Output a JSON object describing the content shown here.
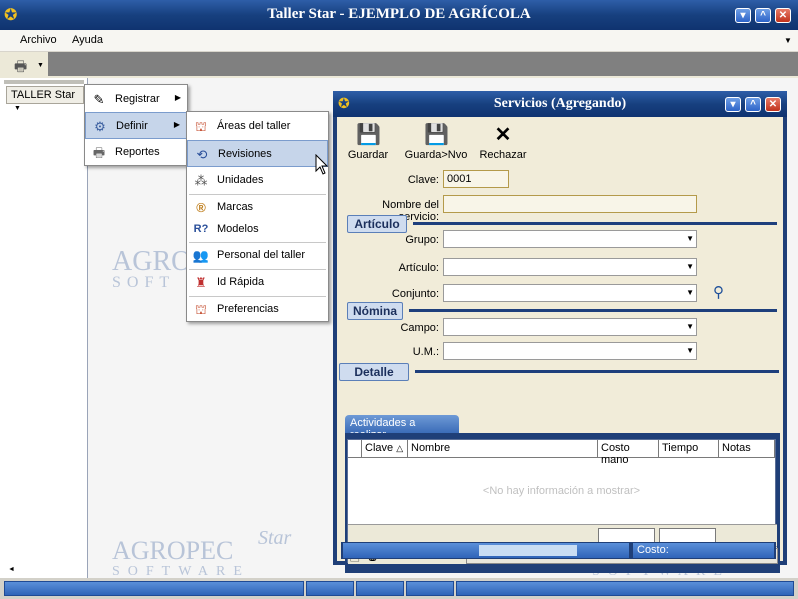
{
  "main_window": {
    "title": "Taller Star - EJEMPLO DE AGRÍCOLA",
    "menu": [
      "Archivo",
      "Ayuda"
    ],
    "taller_button": "TALLER Star"
  },
  "watermark": {
    "agropec": "AGROPEC",
    "agropec_short": "AGRO",
    "star": "Star",
    "software": "SOFTWARE",
    "soft_short": "SOFT"
  },
  "menu1": {
    "items": [
      {
        "label": "Registrar",
        "icon": "pencil-icon"
      },
      {
        "label": "Definir",
        "icon": "define-icon"
      },
      {
        "label": "Reportes",
        "icon": "printer-icon"
      }
    ]
  },
  "menu2": {
    "items": [
      {
        "label": "Áreas del taller",
        "icon": "areas-icon"
      },
      {
        "label": "Revisiones",
        "icon": "revisions-icon"
      },
      {
        "label": "Unidades",
        "icon": "units-icon"
      },
      {
        "label": "Marcas",
        "icon": "brands-icon"
      },
      {
        "label": "Modelos",
        "icon": "models-icon"
      },
      {
        "label": "Personal del taller",
        "icon": "staff-icon"
      },
      {
        "label": "Id Rápida",
        "icon": "quick-id-icon"
      },
      {
        "label": "Preferencias",
        "icon": "preferences-icon"
      }
    ]
  },
  "dialog": {
    "title": "Servicios (Agregando)",
    "toolbar": {
      "save": "Guardar",
      "save_new": "Guarda>Nvo",
      "reject": "Rechazar"
    },
    "fields": {
      "clave_label": "Clave:",
      "clave_value": "0001",
      "nombre_label": "Nombre del servicio:",
      "nombre_value": "",
      "grupo_label": "Grupo:",
      "articulo_label": "Artículo:",
      "conjunto_label": "Conjunto:",
      "campo_label": "Campo:",
      "um_label": "U.M.:"
    },
    "sections": {
      "articulo": "Artículo",
      "nomina": "Nómina",
      "detalle": "Detalle"
    },
    "tab": "Actividades a realizar",
    "grid": {
      "columns": [
        "Clave",
        "Nombre",
        "Costo mano",
        "Tiempo",
        "Notas"
      ],
      "empty_message": "<No hay información a mostrar>"
    },
    "status": {
      "costo_label": "Costo:"
    }
  }
}
